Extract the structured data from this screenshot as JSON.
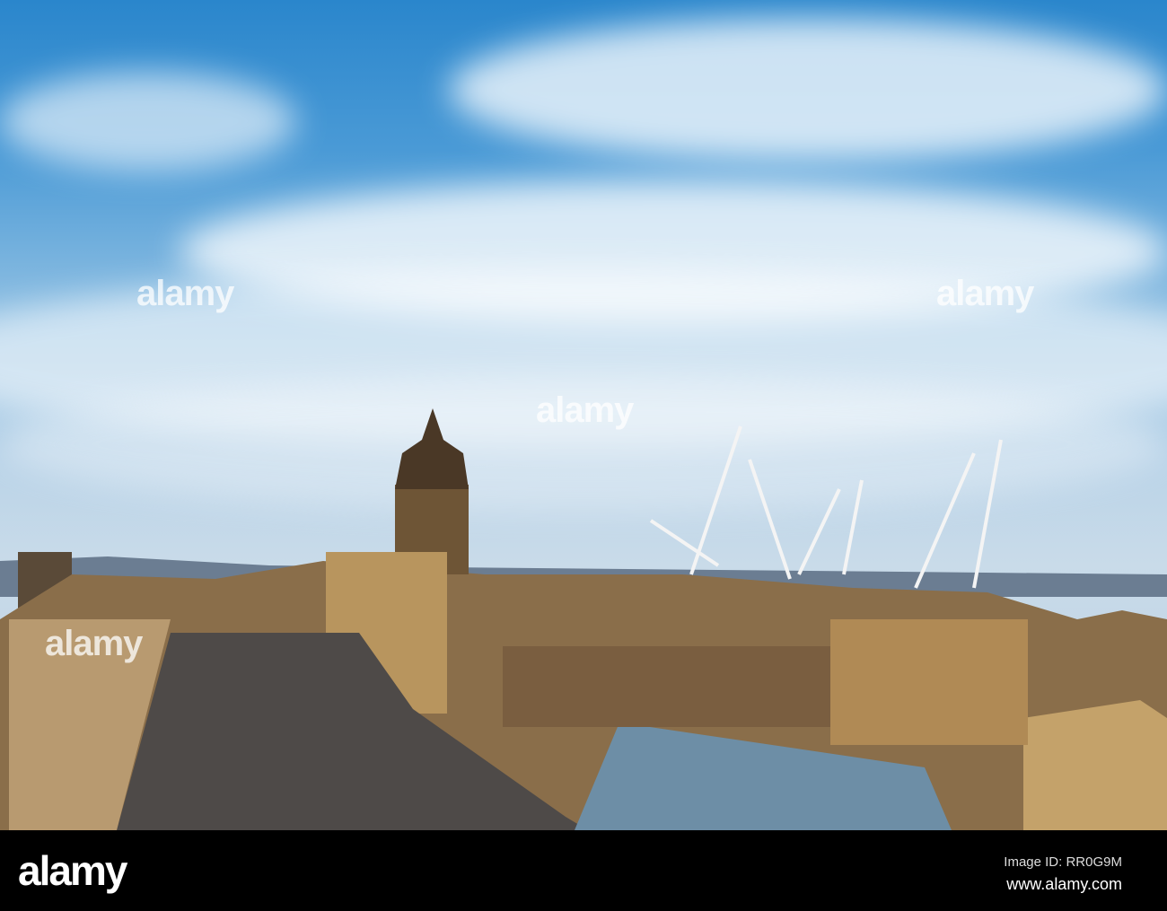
{
  "watermark": {
    "text": "alamy"
  },
  "footer": {
    "logo": "alamy",
    "image_id": "Image ID: RR0G9M",
    "website": "www.alamy.com"
  }
}
